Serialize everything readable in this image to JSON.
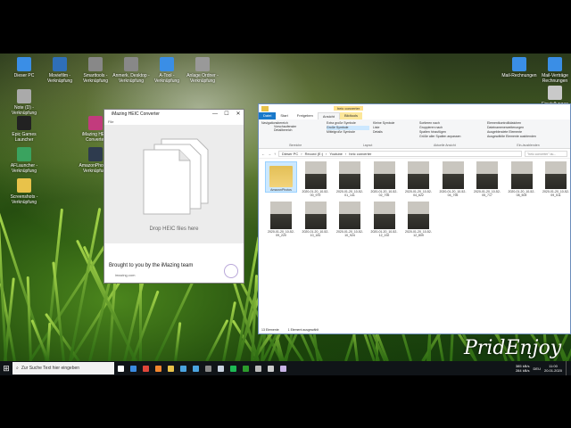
{
  "desktop": {
    "icons": [
      {
        "label": "Dieser PC",
        "color": "#3a8ee6"
      },
      {
        "label": "Moviefilm - Verknüpfung",
        "color": "#2f6fb8"
      },
      {
        "label": "Smarttools - Verknüpfung",
        "color": "#888888"
      },
      {
        "label": "Anmerk. Desktop - Verknüpfung",
        "color": "#888888"
      },
      {
        "label": "A-Tool - Verknüpfung",
        "color": "#3a8ee6"
      },
      {
        "label": "Anlage Ordner - Verknüpfung",
        "color": "#999999"
      },
      {
        "label": "Note (D) - Verknüpfung",
        "color": "#aaaaaa"
      },
      {
        "label": "Epic Games Launcher",
        "color": "#222222"
      },
      {
        "label": "iMazing HEIC Converter",
        "color": "#c23b7d"
      },
      {
        "label": "AFLauncher - Verknüpfung",
        "color": "#3aa35f"
      },
      {
        "label": "AmazonPhotos - Verknüpfung",
        "color": "#2e3b4e"
      },
      {
        "label": "Screenshots - Verknüpfung",
        "color": "#e8c24a"
      },
      {
        "label": "Mail-Rechnungen",
        "color": "#3a8ee6"
      },
      {
        "label": "Mail-Verträge Rechnungen",
        "color": "#3a8ee6"
      },
      {
        "label": "Einstellungen",
        "color": "#c9c9c9"
      }
    ],
    "watermark": "PridEnjoy"
  },
  "imazing": {
    "title": "iMazing HEIC Converter",
    "menu": "File",
    "drop_text": "Drop HEIC files here",
    "footer_text": "Brought to you by the iMazing team",
    "footer_link": "imazing.com",
    "controls": {
      "minimize": "—",
      "maximize": "☐",
      "close": "✕"
    }
  },
  "explorer": {
    "title": "heic converter",
    "tabs": [
      "Datei",
      "Start",
      "Freigeben",
      "Ansicht",
      "Bildtools"
    ],
    "active_tab": "Ansicht",
    "ribbon_groups": [
      "Bereiche",
      "Layout",
      "Aktuelle Ansicht",
      "Ein-/ausblenden"
    ],
    "ribbon_items": {
      "bereiche": [
        "Navigationsbereich",
        "Vorschaufenster",
        "Detailbereich"
      ],
      "layout": [
        "Extra große Symbole",
        "Große Symbole",
        "Mittelgroße Symbole",
        "Kleine Symbole",
        "Liste",
        "Details"
      ],
      "aktuelle": [
        "Sortieren nach",
        "Gruppieren nach",
        "Spalten hinzufügen",
        "Größe aller Spalten anpassen"
      ],
      "einblenden": [
        "Elementkontrollkästchen",
        "Dateinamenerweiterungen",
        "Ausgeblendete Elemente",
        "Ausgewählte Elemente ausblenden"
      ]
    },
    "breadcrumb": [
      "Dieser PC",
      "Record (E:)",
      "Youtube",
      "heic converter"
    ],
    "search_placeholder": "\"heic converter\" du...",
    "files": [
      {
        "name": "AmazonPhotos",
        "type": "folder"
      },
      {
        "name": "2020-01-20_10-52-00_979"
      },
      {
        "name": "2020-01-20_10-52-01_141"
      },
      {
        "name": "2020-01-20_10-52-02_795"
      },
      {
        "name": "2020-01-20_10-52-04_622"
      },
      {
        "name": "2020-01-20_10-52-04_795"
      },
      {
        "name": "2020-01-20_10-52-05_717"
      },
      {
        "name": "2020-01-20_10-52-08_509"
      },
      {
        "name": "2020-01-20_10-52-09_511"
      },
      {
        "name": "2020-01-20_10-52-09_220"
      },
      {
        "name": "2020-01-20_10-52-10_181"
      },
      {
        "name": "2020-01-20_10-52-10_924"
      },
      {
        "name": "2020-01-20_10-52-12_192"
      },
      {
        "name": "2020-01-20_10-52-12_809"
      }
    ],
    "status_count": "13 Elemente",
    "status_selected": "1 Element ausgewählt"
  },
  "taskbar": {
    "search_placeholder": "Zur Suche Text hier eingeben",
    "apps": [
      {
        "name": "task-view",
        "color": "#ffffff"
      },
      {
        "name": "edge",
        "color": "#3b8be0"
      },
      {
        "name": "chrome",
        "color": "#e0463a"
      },
      {
        "name": "firefox",
        "color": "#f2862e"
      },
      {
        "name": "explorer",
        "color": "#e8c24a"
      },
      {
        "name": "store",
        "color": "#4aa3df"
      },
      {
        "name": "mail",
        "color": "#4aa3df"
      },
      {
        "name": "photos",
        "color": "#8a8a8a"
      },
      {
        "name": "steam",
        "color": "#c9d3e0"
      },
      {
        "name": "spotify",
        "color": "#1db954"
      },
      {
        "name": "xbox",
        "color": "#2c9b2c"
      },
      {
        "name": "app",
        "color": "#bbbbbb"
      },
      {
        "name": "settings",
        "color": "#cccccc"
      },
      {
        "name": "imazing",
        "color": "#c9b4e6"
      }
    ],
    "net_up": "385 kB/s",
    "net_down": "284 kB/s",
    "language": "DEU",
    "time": "11:00",
    "date": "20.01.2020"
  }
}
